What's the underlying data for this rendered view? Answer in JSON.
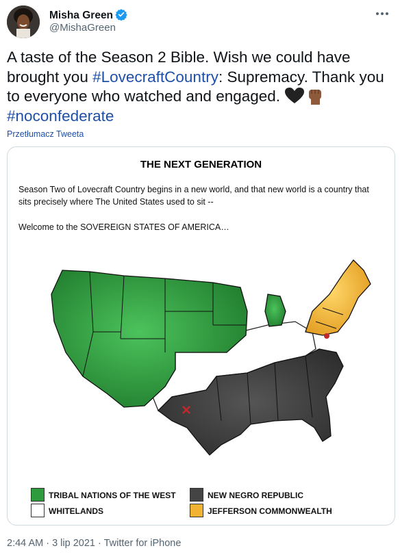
{
  "tweet": {
    "display_name": "Misha Green",
    "handle": "@MishaGreen",
    "text_lines": {
      "part1": "A taste of the Season 2 Bible. Wish we could have brought you ",
      "hashtag1": "#LovecraftCountry",
      "part2": ": Supremacy. Thank you to everyone who watched and engaged. ",
      "hashtag2": "#noconfederate"
    },
    "translate_label": "Przetłumacz Tweeta",
    "timestamp": "2:44 AM · 3 lip 2021 · Twitter for iPhone"
  },
  "media": {
    "title": "THE NEXT GENERATION",
    "paragraph1": "Season Two of Lovecraft Country begins in a new world, and that new world is a country that sits precisely where The United States used to sit --",
    "paragraph2": "Welcome to the SOVEREIGN STATES OF AMERICA…",
    "legend": [
      {
        "label": "TRIBAL NATIONS OF THE WEST",
        "color": "#2e9b3e"
      },
      {
        "label": "NEW NEGRO REPUBLIC",
        "color": "#444444"
      },
      {
        "label": "WHITELANDS",
        "color": "#ffffff"
      },
      {
        "label": "JEFFERSON COMMONWEALTH",
        "color": "#f2b332"
      }
    ]
  },
  "colors": {
    "accent": "#1d9bf0",
    "link": "#1d4fa7",
    "muted": "#536471",
    "border": "#cfd9de"
  },
  "icons": [
    "verified-badge-icon",
    "more-options-icon",
    "black-heart-emoji",
    "raised-fist-emoji"
  ]
}
